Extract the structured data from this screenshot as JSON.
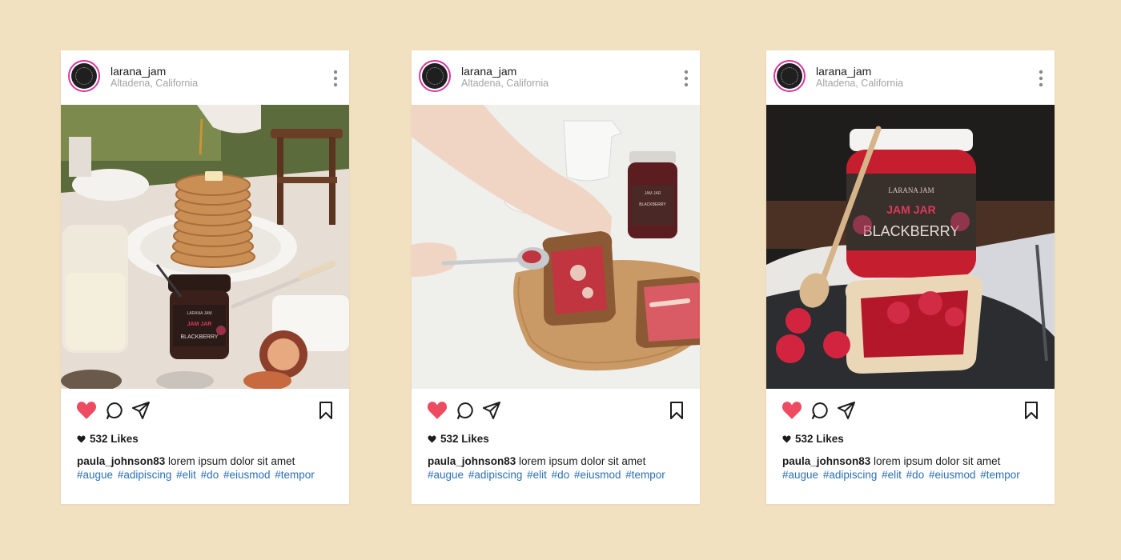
{
  "colors": {
    "background": "#f2e1c0",
    "card": "#ffffff",
    "heart": "#ec4b62",
    "avatar_ring": "#d6379e",
    "hashtag": "#2a6fb8"
  },
  "posts": [
    {
      "username": "larana_jam",
      "location": "Altadena, California",
      "likes": "532 Likes",
      "caption_user": "paula_johnson83",
      "caption_text": "lorem ipsum dolor sit amet",
      "hashtags": [
        "#augue",
        "#adipiscing",
        "#elit",
        "#do",
        "#eiusmod",
        "#tempor"
      ],
      "icons": [
        "heart-icon",
        "comment-icon",
        "share-icon",
        "bookmark-icon",
        "more-icon"
      ]
    },
    {
      "username": "larana_jam",
      "location": "Altadena, California",
      "likes": "532 Likes",
      "caption_user": "paula_johnson83",
      "caption_text": "lorem ipsum dolor sit amet",
      "hashtags": [
        "#augue",
        "#adipiscing",
        "#elit",
        "#do",
        "#eiusmod",
        "#tempor"
      ],
      "icons": [
        "heart-icon",
        "comment-icon",
        "share-icon",
        "bookmark-icon",
        "more-icon"
      ]
    },
    {
      "username": "larana_jam",
      "location": "Altadena, California",
      "likes": "532 Likes",
      "caption_user": "paula_johnson83",
      "caption_text": "lorem ipsum dolor sit amet",
      "hashtags": [
        "#augue",
        "#adipiscing",
        "#elit",
        "#do",
        "#eiusmod",
        "#tempor"
      ],
      "icons": [
        "heart-icon",
        "comment-icon",
        "share-icon",
        "bookmark-icon",
        "more-icon"
      ]
    }
  ],
  "jar_labels": {
    "brand": "LARANA JAM",
    "product": "JAM JAR",
    "flavor": "BLACKBERRY"
  }
}
